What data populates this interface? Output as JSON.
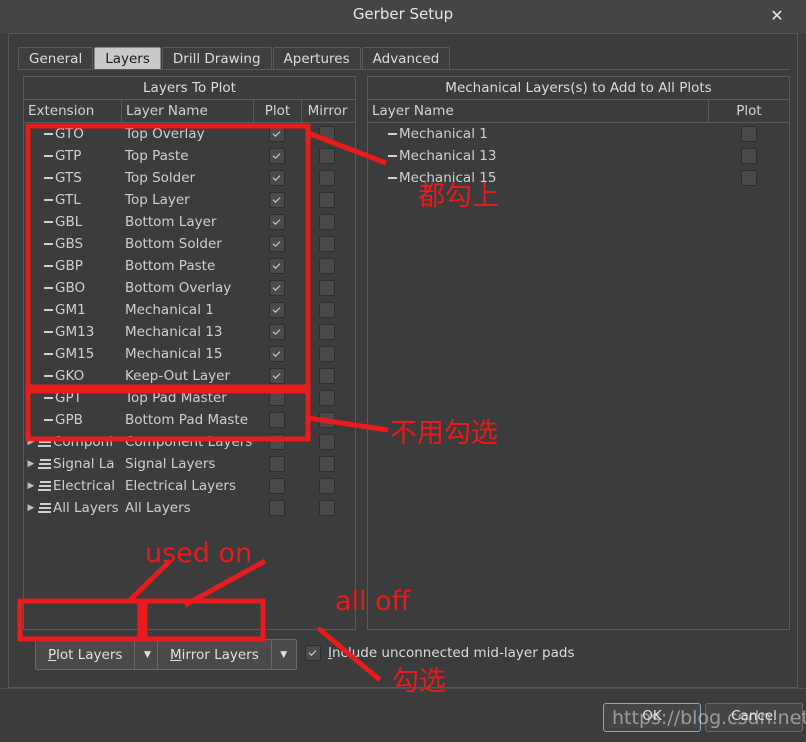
{
  "window": {
    "title": "Gerber Setup",
    "close_icon": "close-icon"
  },
  "tabs": [
    {
      "label": "General",
      "active": false
    },
    {
      "label": "Layers",
      "active": true
    },
    {
      "label": "Drill Drawing",
      "active": false
    },
    {
      "label": "Apertures",
      "active": false
    },
    {
      "label": "Advanced",
      "active": false
    }
  ],
  "left_panel": {
    "caption": "Layers To Plot",
    "headers": [
      "Extension",
      "Layer Name",
      "Plot",
      "Mirror"
    ],
    "rows": [
      {
        "extension": "GTO",
        "name": "Top Overlay",
        "plot": true,
        "mirror": false
      },
      {
        "extension": "GTP",
        "name": "Top Paste",
        "plot": true,
        "mirror": false
      },
      {
        "extension": "GTS",
        "name": "Top Solder",
        "plot": true,
        "mirror": false
      },
      {
        "extension": "GTL",
        "name": "Top Layer",
        "plot": true,
        "mirror": false
      },
      {
        "extension": "GBL",
        "name": "Bottom Layer",
        "plot": true,
        "mirror": false
      },
      {
        "extension": "GBS",
        "name": "Bottom Solder",
        "plot": true,
        "mirror": false
      },
      {
        "extension": "GBP",
        "name": "Bottom Paste",
        "plot": true,
        "mirror": false
      },
      {
        "extension": "GBO",
        "name": "Bottom Overlay",
        "plot": true,
        "mirror": false
      },
      {
        "extension": "GM1",
        "name": "Mechanical 1",
        "plot": true,
        "mirror": false
      },
      {
        "extension": "GM13",
        "name": "Mechanical 13",
        "plot": true,
        "mirror": false
      },
      {
        "extension": "GM15",
        "name": "Mechanical 15",
        "plot": true,
        "mirror": false
      },
      {
        "extension": "GKO",
        "name": "Keep-Out Layer",
        "plot": true,
        "mirror": false
      },
      {
        "extension": "GPT",
        "name": "Top Pad Master",
        "plot": false,
        "mirror": false
      },
      {
        "extension": "GPB",
        "name": "Bottom Pad Maste",
        "plot": false,
        "mirror": false
      }
    ],
    "groups": [
      {
        "extension": "Componi",
        "name": "Component Layers",
        "plot": false,
        "mirror": false
      },
      {
        "extension": "Signal La",
        "name": "Signal Layers",
        "plot": false,
        "mirror": false
      },
      {
        "extension": "Electrical",
        "name": "Electrical Layers",
        "plot": false,
        "mirror": false
      },
      {
        "extension": "All Layers",
        "name": "All Layers",
        "plot": false,
        "mirror": false
      }
    ]
  },
  "right_panel": {
    "caption": "Mechanical Layers(s) to Add to All Plots",
    "headers": [
      "Layer Name",
      "Plot"
    ],
    "rows": [
      {
        "name": "Mechanical 1",
        "plot": false
      },
      {
        "name": "Mechanical 13",
        "plot": false
      },
      {
        "name": "Mechanical 15",
        "plot": false
      }
    ]
  },
  "bottom": {
    "plot_layers": {
      "mnemonic": "P",
      "rest": "lot Layers"
    },
    "mirror_layers": {
      "mnemonic": "M",
      "rest": "irror Layers"
    },
    "include_pads": {
      "mnemonic": "I",
      "rest": "nclude unconnected mid-layer pads",
      "checked": true
    }
  },
  "footer": {
    "ok": "OK",
    "cancel": "Cancel"
  },
  "annotations": {
    "accent_color": "#e81c1c",
    "check_all": "都勾上",
    "no_check": "不用勾选",
    "used_on": "used on",
    "all_off": "all off",
    "check_it": "勾选"
  },
  "watermark": {
    "text": "https://blog.csdn.net/clyrjj"
  }
}
